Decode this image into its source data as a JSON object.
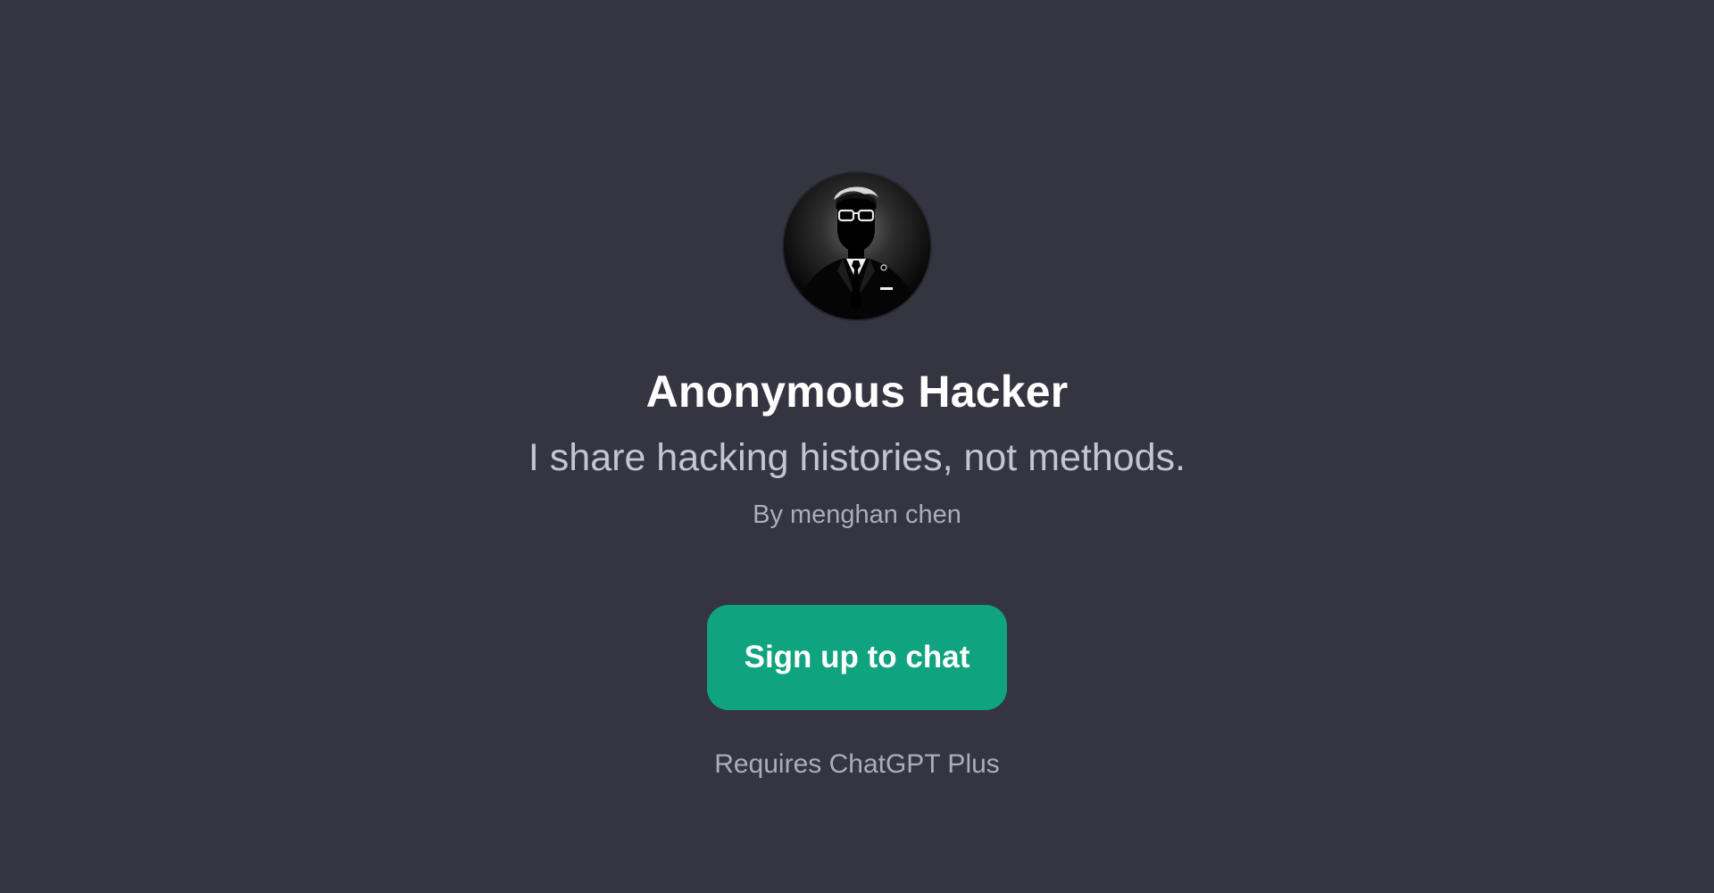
{
  "gpt": {
    "avatar_icon": "hacker-avatar-icon",
    "name": "Anonymous Hacker",
    "description": "I share hacking histories, not methods.",
    "author": "By menghan chen"
  },
  "actions": {
    "signup_label": "Sign up to chat",
    "requirement": "Requires ChatGPT Plus"
  },
  "colors": {
    "background": "#343541",
    "accent": "#10a37f",
    "title": "#ffffff",
    "subtitle": "#c5c5d2",
    "muted": "#acacbe"
  }
}
